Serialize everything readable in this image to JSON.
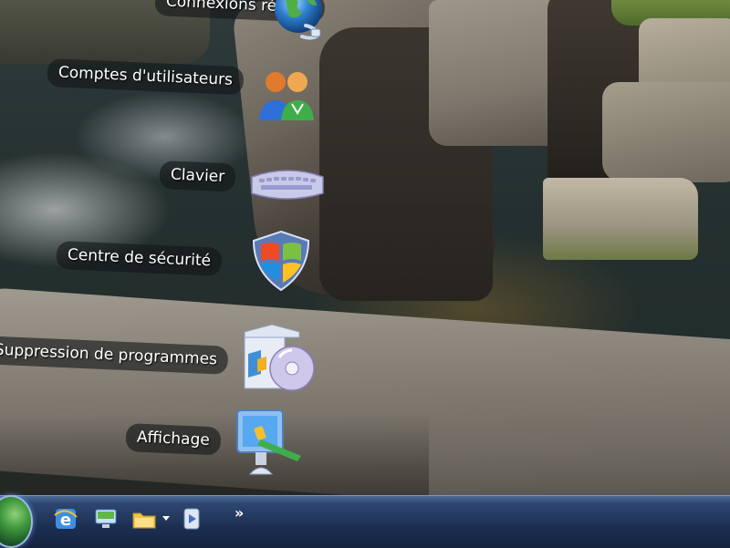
{
  "desktop": {
    "items": [
      {
        "label": "Connexions réseau",
        "icon": "network-globe-icon"
      },
      {
        "label": "Comptes d'utilisateurs",
        "icon": "user-accounts-icon"
      },
      {
        "label": "Clavier",
        "icon": "keyboard-icon"
      },
      {
        "label": "Centre de sécurité",
        "icon": "security-shield-icon"
      },
      {
        "label": "Ajout/Suppression de programmes",
        "icon": "add-remove-programs-icon"
      },
      {
        "label": "Affichage",
        "icon": "display-icon"
      }
    ]
  },
  "taskbar": {
    "start_icon": "windows-start-orb-icon",
    "quick_launch": [
      {
        "icon": "internet-explorer-icon"
      },
      {
        "icon": "show-desktop-icon"
      },
      {
        "icon": "folder-icon"
      },
      {
        "icon": "media-player-icon"
      }
    ],
    "overflow_label": "»"
  },
  "colors": {
    "taskbar_top": "#4e6c99",
    "taskbar_bottom": "#16233f",
    "label_bg": "rgba(20,22,24,0.62)",
    "label_text": "#ffffff"
  }
}
